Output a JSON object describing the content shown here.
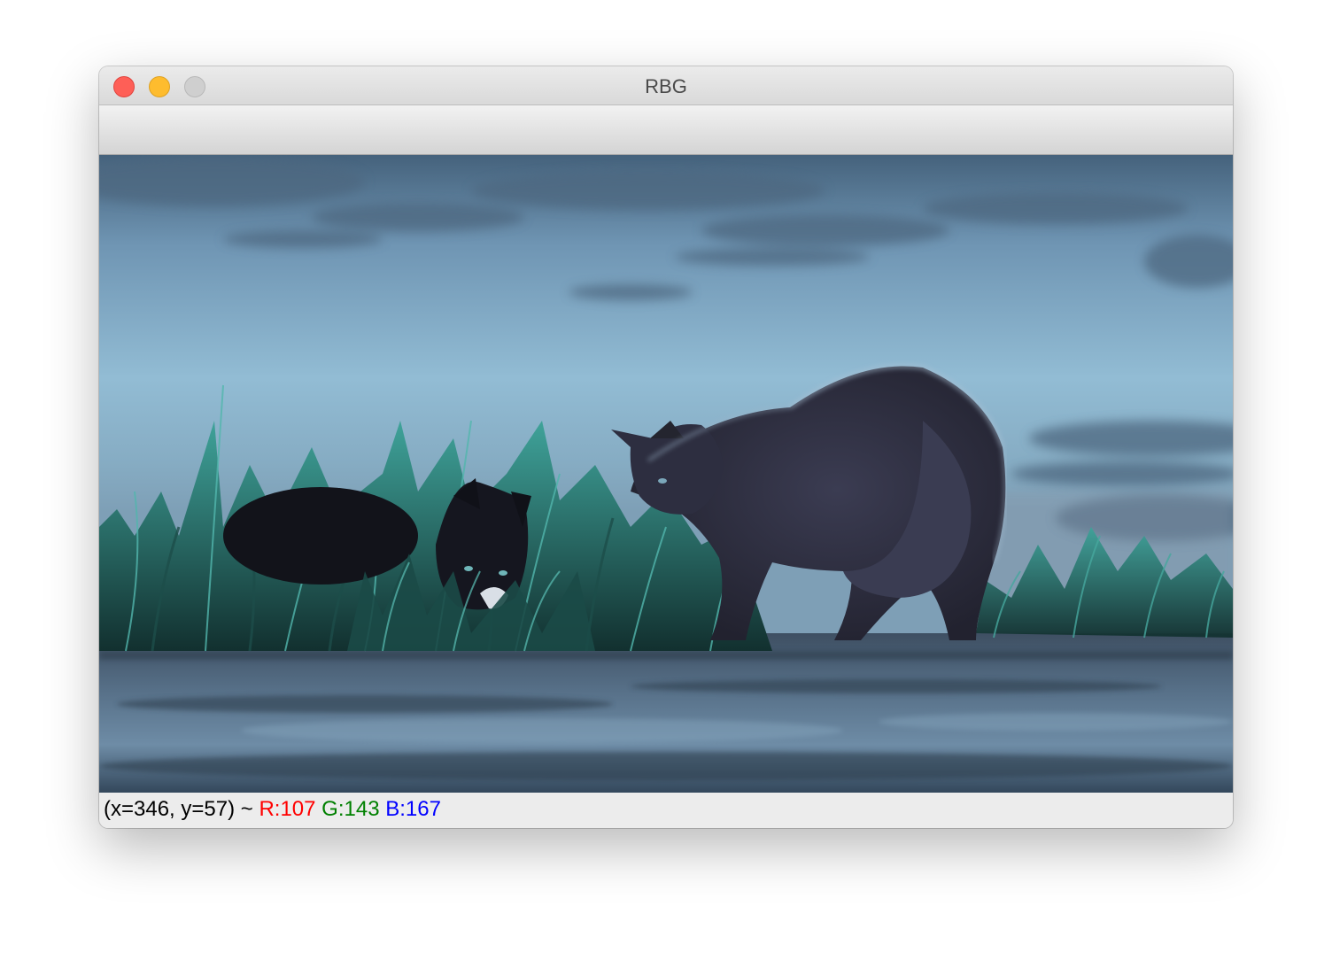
{
  "window": {
    "title": "RBG"
  },
  "image": {
    "description_icon": "photo-image"
  },
  "status": {
    "coords": "(x=346, y=57) ~",
    "r_label": "R:107",
    "g_label": "G:143",
    "b_label": "B:167"
  },
  "colors": {
    "close": "#fe5f57",
    "minimize": "#febc2e",
    "zoom_disabled": "#cfcfcf",
    "r_text": "#ff0000",
    "g_text": "#008000",
    "b_text": "#0000ff"
  }
}
